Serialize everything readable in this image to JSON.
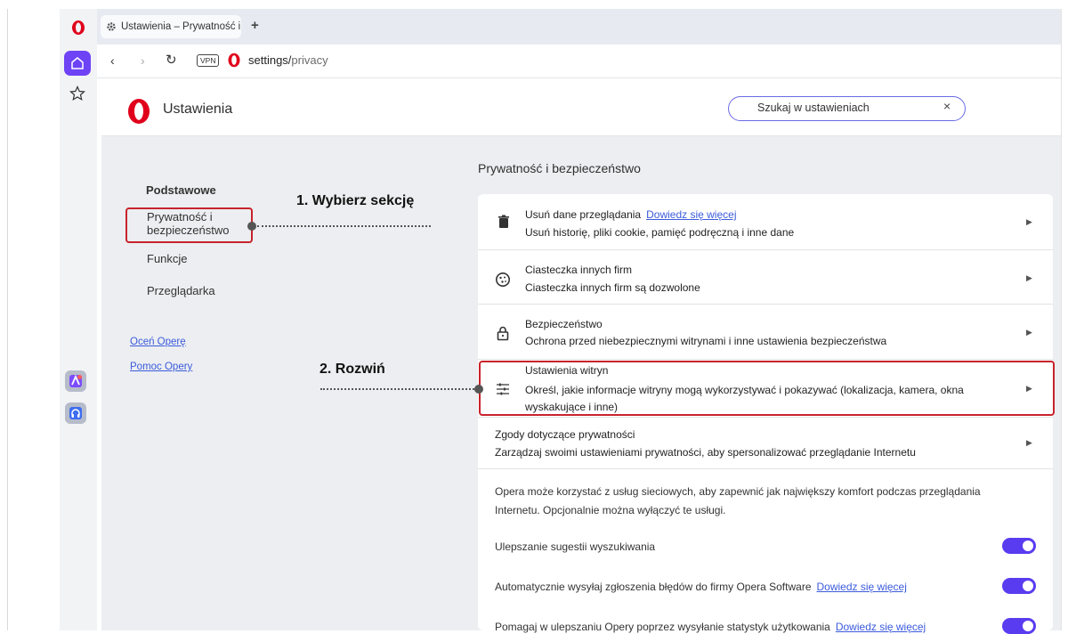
{
  "tab": {
    "title": "Ustawienia – Prywatność i",
    "add": "+"
  },
  "address": {
    "vpn": "VPN",
    "host": "settings/",
    "path": "privacy"
  },
  "header": {
    "title": "Ustawienia",
    "search_placeholder": "Szukaj w ustawieniach",
    "search_clear": "×"
  },
  "nav": {
    "items": [
      "Podstawowe",
      "Prywatność i bezpieczeństwo",
      "Funkcje",
      "Przeglądarka"
    ],
    "links": [
      "Oceń Operę",
      "Pomoc Opery"
    ]
  },
  "section": {
    "title": "Prywatność i bezpieczeństwo"
  },
  "rows": [
    {
      "title": "Usuń dane przeglądania",
      "link": "Dowiedz się więcej",
      "sub": "Usuń historię, pliki cookie, pamięć podręczną i inne dane",
      "icon": "trash-icon"
    },
    {
      "title": "Ciasteczka innych firm",
      "sub": "Ciasteczka innych firm są dozwolone",
      "icon": "cookie-icon"
    },
    {
      "title": "Bezpieczeństwo",
      "sub": "Ochrona przed niebezpiecznymi witrynami i inne ustawienia bezpieczeństwa",
      "icon": "lock-icon"
    },
    {
      "title": "Ustawienia witryn",
      "sub": "Określ, jakie informacje witryny mogą wykorzystywać i pokazywać (lokalizacja, kamera, okna wyskakujące i inne)",
      "icon": "sliders-icon"
    },
    {
      "title": "Zgody dotyczące prywatności",
      "sub": "Zarządzaj swoimi ustawieniami prywatności, aby spersonalizować przeglądanie Internetu"
    }
  ],
  "description": "Opera może korzystać z usług sieciowych, aby zapewnić jak największy komfort podczas przeglądania Internetu. Opcjonalnie można wyłączyć te usługi.",
  "toggles": [
    {
      "label": "Ulepszanie sugestii wyszukiwania",
      "on": true
    },
    {
      "label": "Automatycznie wysyłaj zgłoszenia błędów do firmy Opera Software",
      "link": "Dowiedz się więcej",
      "on": true
    },
    {
      "label": "Pomagaj w ulepszaniu Opery poprzez wysyłanie statystyk użytkowania",
      "link": "Dowiedz się więcej",
      "on": true
    }
  ],
  "annotations": {
    "step1": "1. Wybierz sekcję",
    "step2": "2. Rozwiń"
  },
  "colors": {
    "accent": "#5a3cf0",
    "highlight": "#c8232c",
    "opera_red": "#e0001b",
    "link": "#3b5bdb"
  }
}
